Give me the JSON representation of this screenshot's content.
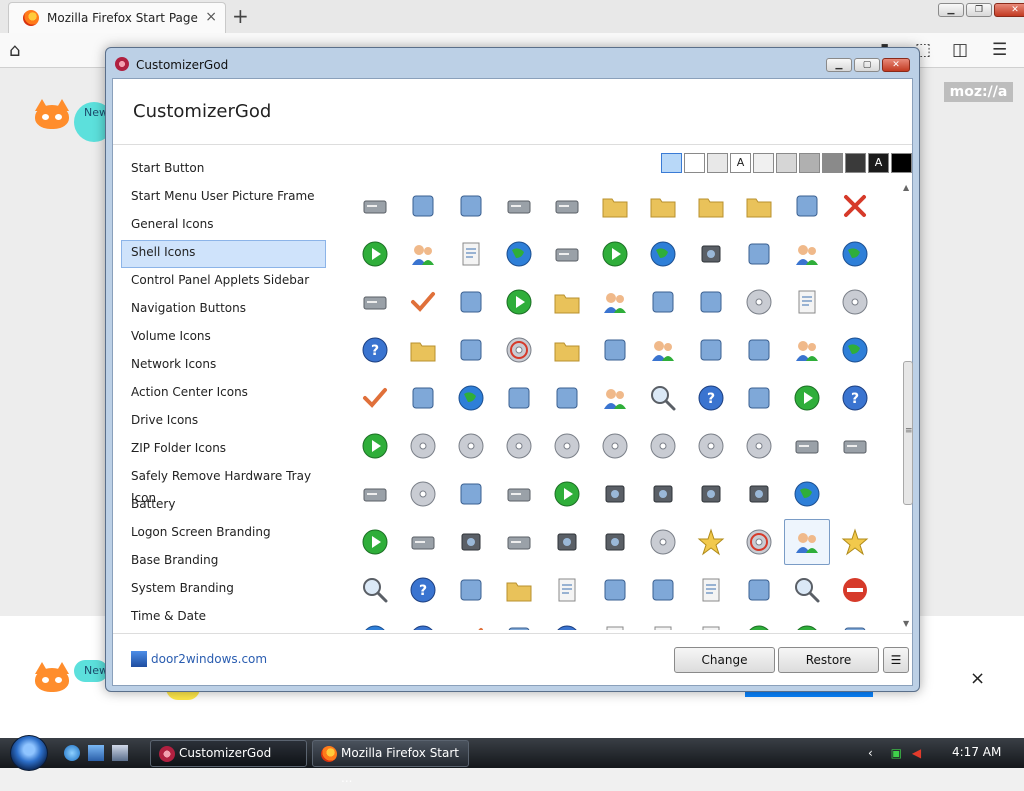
{
  "firefox": {
    "tab_title": "Mozilla Firefox Start Page",
    "newtab_symbol": "+",
    "close_symbol": "×",
    "bubble_text": "New",
    "banner_bubble_text": "New",
    "logo": "moz://a"
  },
  "cg": {
    "window_title": "CustomizerGod",
    "header_title": "CustomizerGod",
    "sidebar": [
      "Start Button",
      "Start Menu User Picture Frame",
      "General Icons",
      "Shell Icons",
      "Control Panel Applets Sidebar",
      "Navigation Buttons",
      "Volume Icons",
      "Network Icons",
      "Action Center Icons",
      "Drive Icons",
      "ZIP Folder Icons",
      "Safely Remove Hardware Tray Icon",
      "Battery",
      "Logon Screen Branding",
      "Base Branding",
      "System Branding",
      "Time & Date"
    ],
    "selected_sidebar": "Shell Icons",
    "swatches": [
      {
        "label": "",
        "bg": "#b8d8f8"
      },
      {
        "label": "",
        "bg": "#ffffff"
      },
      {
        "label": "",
        "bg": "#e8e8e8"
      },
      {
        "label": "A",
        "bg": "#ffffff"
      },
      {
        "label": "",
        "bg": "#f0f0f0"
      },
      {
        "label": "",
        "bg": "#d6d6d6"
      },
      {
        "label": "",
        "bg": "#b0b0b0"
      },
      {
        "label": "",
        "bg": "#8a8a8a"
      },
      {
        "label": "",
        "bg": "#3a3a3a"
      },
      {
        "label": "A",
        "bg": "#1a1a1a"
      },
      {
        "label": "",
        "bg": "#000000"
      }
    ],
    "footer_link": "door2windows.com",
    "change_label": "Change",
    "restore_label": "Restore",
    "menu_label": "☰",
    "icons": [
      [
        "drive-icon",
        "download-icon",
        "small-download-icon",
        "hard-drive-icon",
        "printer-cancel-icon",
        "folder-icon",
        "folder-picture-icon",
        "folder-music-icon",
        "folder-video-icon",
        "msn-butterfly-icon",
        "red-x-icon"
      ],
      [
        "document-arrow-icon",
        "network-adapter-icon",
        "documents-icon",
        "globe-arrow-icon",
        "printer-icon",
        "green-play-icon",
        "globe-icon",
        "camera-icon",
        "projector-icon",
        "network-tools-icon",
        "globe-picture-icon"
      ],
      [
        "fax-icon",
        "checkmark-icon",
        "recycle-bin-icon",
        "green-arrow-icon",
        "warning-folder-icon",
        "network-computers-icon",
        "move-icon",
        "home-icon",
        "cd-icon",
        "document-remove-icon",
        "disc-search-icon"
      ],
      [
        "help-icon",
        "folder-open-icon",
        "mail-icon",
        "cd-red-icon",
        "users-folder-icon",
        "fullscreen-icon",
        "users-icon",
        "color-management-icon",
        "program-files-icon",
        "print-network-icon",
        "globe-network-icon"
      ],
      [
        "checklist-icon",
        "clock-pie-icon",
        "globe-clock-icon",
        "speaker-icon",
        "safe-icon",
        "user-group-icon",
        "search-window-icon",
        "help-hint-icon",
        "keyboard-icon",
        "display-icon",
        "help-box-icon"
      ],
      [
        "green-arrow-right-icon",
        "dvd-drive-icon",
        "cd-add-icon",
        "disc-help-icon",
        "cd-rom-icon",
        "cd-r-icon",
        "cd-rw-icon",
        "dvd-ram-icon",
        "dvd-r-icon",
        "scanner-icon",
        "server-icon"
      ],
      [
        "hard-drive-gray-icon",
        "cd-silver-icon",
        "floppy-icon",
        "hard-drive-flat-icon",
        "media-player-icon",
        "memory-card-icon",
        "sd-card-icon",
        "camera-small-icon",
        "phone-icon",
        "printer-globe-icon",
        ""
      ],
      [
        "drive-green-icon",
        "drive-blue-icon",
        "pda-icon",
        "scanner-flat-icon",
        "camera-flat-icon",
        "video-camera-icon",
        "dvd-rw-icon",
        "sun-note-icon",
        "cd-red-small-icon",
        "network-map-icon",
        "star-icon"
      ],
      [
        "magnifier-icon",
        "help-circle-icon",
        "key-icon",
        "calendar-folder-icon",
        "document-settings-icon",
        "window-icon",
        "power-box-icon",
        "certificate-icon",
        "eject-icon",
        "search-tools-icon",
        "no-entry-icon"
      ],
      [
        "ie-icon",
        "info-icon",
        "check-doc-icon",
        "book-icon",
        "help-doc-icon",
        "small-doc-icon",
        "small-doc2-icon",
        "tools-doc-icon",
        "green-doc-icon",
        "green-doc2-icon",
        "pencil-icon"
      ]
    ],
    "selected_icon": [
      7,
      9
    ]
  },
  "taskbar": {
    "items": [
      "CustomizerGod",
      "Mozilla Firefox Start ..."
    ],
    "tray_chevron": "‹",
    "time": "4:17 AM"
  }
}
